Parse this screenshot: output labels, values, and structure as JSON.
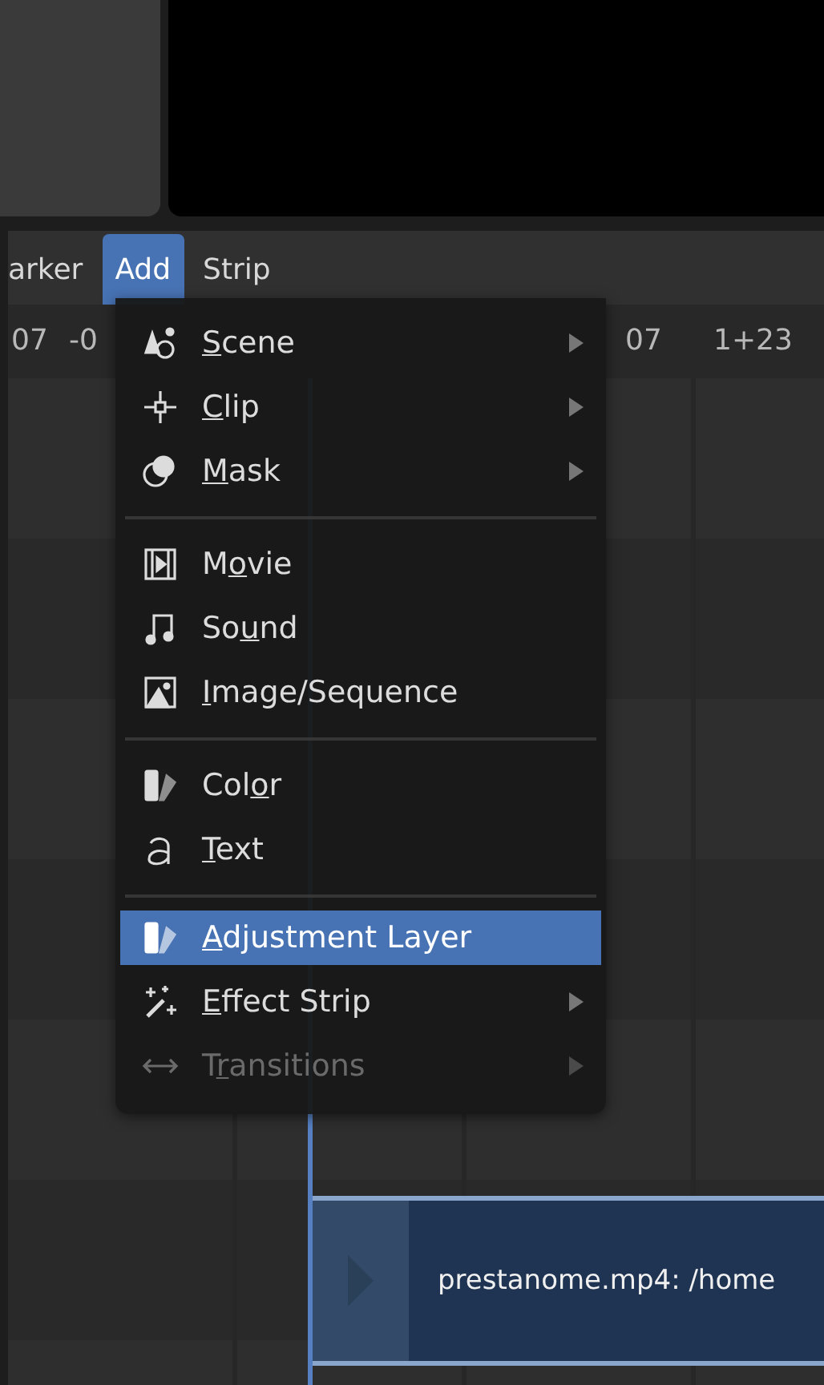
{
  "header": {
    "menus": [
      {
        "label": "arker",
        "selected": false
      },
      {
        "label": "Add",
        "selected": true
      },
      {
        "label": "Strip",
        "selected": false
      }
    ]
  },
  "ruler": {
    "left_labels": [
      "07",
      "-0"
    ],
    "right_labels": [
      "07",
      "1+23"
    ]
  },
  "menu": {
    "items": [
      {
        "kind": "item",
        "mnemonic": "S",
        "after": "cene",
        "submenu": true,
        "selected": false,
        "disabled": false
      },
      {
        "kind": "item",
        "mnemonic": "C",
        "after": "lip",
        "submenu": true,
        "selected": false,
        "disabled": false
      },
      {
        "kind": "item",
        "mnemonic": "M",
        "after": "ask",
        "submenu": true,
        "selected": false,
        "disabled": false
      },
      {
        "kind": "separator"
      },
      {
        "kind": "item",
        "before": "M",
        "mnemonic": "o",
        "after": "vie",
        "submenu": false,
        "selected": false,
        "disabled": false
      },
      {
        "kind": "item",
        "before": "So",
        "mnemonic": "u",
        "after": "nd",
        "submenu": false,
        "selected": false,
        "disabled": false
      },
      {
        "kind": "item",
        "mnemonic": "I",
        "after": "mage/Sequence",
        "submenu": false,
        "selected": false,
        "disabled": false
      },
      {
        "kind": "separator"
      },
      {
        "kind": "item",
        "before": "Col",
        "mnemonic": "o",
        "after": "r",
        "submenu": false,
        "selected": false,
        "disabled": false
      },
      {
        "kind": "item",
        "mnemonic": "T",
        "after": "ext",
        "submenu": false,
        "selected": false,
        "disabled": false
      },
      {
        "kind": "separator"
      },
      {
        "kind": "item",
        "mnemonic": "A",
        "after": "djustment Layer",
        "submenu": false,
        "selected": true,
        "disabled": false
      },
      {
        "kind": "item",
        "mnemonic": "E",
        "after": "ffect Strip",
        "submenu": true,
        "selected": false,
        "disabled": false
      },
      {
        "kind": "item",
        "before": "T",
        "mnemonic": "r",
        "after": "ansitions",
        "submenu": true,
        "selected": false,
        "disabled": true
      }
    ]
  },
  "strip": {
    "label": "prestanome.mp4: /home"
  }
}
